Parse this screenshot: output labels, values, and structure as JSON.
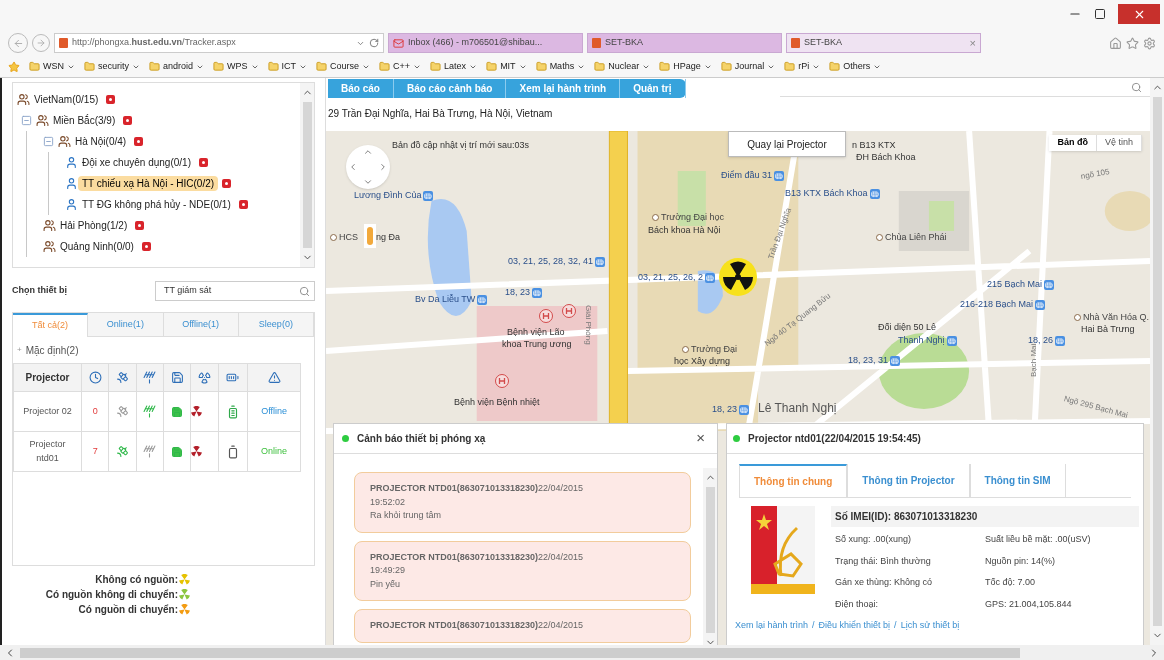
{
  "browser": {
    "url": "http://phongxa.**hust.edu.vn**/Tracker.aspx",
    "tabs": [
      {
        "label": "Inbox (466) - m706501@shibau...",
        "kind": "mail",
        "selected": false
      },
      {
        "label": "SET-BKA",
        "kind": "site",
        "selected": false
      },
      {
        "label": "SET-BKA",
        "kind": "site",
        "selected": true
      }
    ],
    "close_tab": "×",
    "bookmarks": [
      "WSN",
      "security",
      "android",
      "WPS",
      "ICT",
      "Course",
      "C++",
      "Latex",
      "MIT",
      "Maths",
      "Nuclear",
      "HPage",
      "Journal",
      "rPi",
      "Others"
    ]
  },
  "tree": [
    {
      "label": "VietNam(0/15)",
      "kind": "group",
      "selected": false,
      "children": [
        {
          "label": "Miền Bắc(3/9)",
          "kind": "group",
          "selected": false,
          "children": [
            {
              "label": "Hà Nội(0/4)",
              "kind": "group",
              "selected": false,
              "children": [
                {
                  "label": "Đội xe chuyên dụng(0/1)",
                  "kind": "unit",
                  "selected": false
                },
                {
                  "label": "TT chiếu xạ Hà Nội - HIC(0/2)",
                  "kind": "unit",
                  "selected": true
                },
                {
                  "label": "TT ĐG không phá hủy - NDE(0/1)",
                  "kind": "unit",
                  "selected": false
                }
              ]
            },
            {
              "label": "Hải Phòng(1/2)",
              "kind": "group",
              "selected": false
            },
            {
              "label": "Quảng Ninh(0/0)",
              "kind": "group",
              "selected": false
            }
          ]
        }
      ]
    }
  ],
  "device_picker": {
    "label": "Chọn thiết bị",
    "value": "TT giám sát"
  },
  "device_tabs": [
    {
      "label": "Tất cả(2)",
      "selected": true
    },
    {
      "label": "Online(1)",
      "selected": false
    },
    {
      "label": "Offline(1)",
      "selected": false
    },
    {
      "label": "Sleep(0)",
      "selected": false
    }
  ],
  "group": {
    "toggle": "+",
    "label": "Mặc định(2)"
  },
  "device_table": {
    "column": "Projector",
    "rows": [
      {
        "name": "Projector 02",
        "count": "0",
        "gps": false,
        "signal": true,
        "battery_full": true,
        "status": "Offline",
        "online": false
      },
      {
        "name": "Projector ntd01",
        "count": "7",
        "gps": true,
        "signal": false,
        "battery_full": false,
        "status": "Online",
        "online": true
      }
    ]
  },
  "legend": [
    {
      "label": "Không có nguồn:",
      "color": "#e6c200"
    },
    {
      "label": "Có nguồn không di chuyển:",
      "color": "#8cc63f"
    },
    {
      "label": "Có nguồn di chuyển:",
      "color": "#f39c12"
    }
  ],
  "nav": [
    "Báo cáo",
    "Báo cáo cảnh báo",
    "Xem lại hành trình",
    "Quản trị"
  ],
  "address_line": "29 Trần Đại Nghĩa, Hai Bà Trưng, Hà Nội, Vietnam",
  "map": {
    "notice": "Bản đồ cập nhật vị trí mới sau:03s",
    "back_button": "Quay lại Projector",
    "map_types": [
      {
        "label": "Bản đồ",
        "selected": true
      },
      {
        "label": "Vệ tinh",
        "selected": false
      }
    ],
    "labels": [
      {
        "text": "n B13 KTX",
        "kind": "text"
      },
      {
        "text": "ĐH Bách Khoa",
        "kind": "text"
      },
      {
        "text": "Điểm đầu 31",
        "kind": "bus"
      },
      {
        "text": "Lương Đình Của",
        "kind": "bus"
      },
      {
        "text": "B13 KTX Bách Khoa",
        "kind": "bus"
      },
      {
        "text": "HCS",
        "kind": "place"
      },
      {
        "text": "ng Đa",
        "kind": "text"
      },
      {
        "text": "Trường Đại học",
        "kind": "place"
      },
      {
        "text": "Bách khoa Hà Nội",
        "kind": "text"
      },
      {
        "text": "Chùa Liên Phái",
        "kind": "place"
      },
      {
        "text": "03, 21, 25, 28, 32, 41",
        "kind": "bus"
      },
      {
        "text": "03, 21, 25, 26, 2",
        "kind": "bus"
      },
      {
        "text": "18, 23",
        "kind": "bus"
      },
      {
        "text": "Bv Da Liễu TW",
        "kind": "bus"
      },
      {
        "text": "215 Bạch Mai",
        "kind": "bus"
      },
      {
        "text": "216-218 Bạch Mai",
        "kind": "bus"
      },
      {
        "text": "Nhà Văn Hóa Q.",
        "kind": "place"
      },
      {
        "text": "Bệnh viện Lão",
        "kind": "text"
      },
      {
        "text": "Đối diện 50 Lê",
        "kind": "text"
      },
      {
        "text": "Hai Bà Trưng",
        "kind": "text"
      },
      {
        "text": "khoa Trung ương",
        "kind": "text"
      },
      {
        "text": "Thanh Nghị",
        "kind": "bus"
      },
      {
        "text": "18, 26",
        "kind": "bus"
      },
      {
        "text": "Trường Đại",
        "kind": "place"
      },
      {
        "text": "học Xây dựng",
        "kind": "text"
      },
      {
        "text": "18, 23, 31",
        "kind": "bus"
      },
      {
        "text": "Bệnh viện Bệnh nhiệt",
        "kind": "text"
      },
      {
        "text": "18, 23",
        "kind": "bus"
      },
      {
        "text": "Lê Thanh Nghị",
        "kind": "street"
      },
      {
        "text": "Giải Phóng",
        "kind": "road"
      },
      {
        "text": "Trần Đại Nghĩa",
        "kind": "road"
      },
      {
        "text": "Ngõ 40 Tạ Quang Bửu",
        "kind": "road"
      },
      {
        "text": "Bạch Mai",
        "kind": "road"
      },
      {
        "text": "ngõ 105",
        "kind": "road"
      },
      {
        "text": "Ngõ 295 Bạch Mai",
        "kind": "road"
      }
    ]
  },
  "alerts": {
    "title": "Cảnh báo thiết bị phóng xạ",
    "close": "×",
    "items": [
      {
        "title": "**PROJECTOR NTD01(863071013318230)**22/04/2015",
        "time": "19:52:02",
        "message": "Ra khỏi trung tâm"
      },
      {
        "title": "**PROJECTOR NTD01(863071013318230)**22/04/2015",
        "time": "19:49:29",
        "message": "Pin yếu"
      },
      {
        "title": "**PROJECTOR NTD01(863071013318230)**22/04/2015"
      }
    ]
  },
  "device_info": {
    "title": "Projector ntd01(22/04/2015 19:54:45)",
    "tabs": [
      {
        "label": "Thông tin chung",
        "selected": true
      },
      {
        "label": "Thông tin Projector",
        "selected": false
      },
      {
        "label": "Thông tin SIM",
        "selected": false
      }
    ],
    "imei": "Số IMEI(ID): 863071013318230",
    "fields": [
      "Số xung: .00(xung)",
      "Suất liều bề mặt: .00(uSV)",
      "Trạng thái: Bình thường",
      "Nguồn pin: 14(%)",
      "Gán xe thùng: Không có",
      "Tốc độ: 7.00",
      "Điện thoại:",
      "GPS: 21.004,105.844"
    ],
    "links": [
      "Xem lại hành trình",
      "Điều khiển thiết bị",
      "Lịch sử thiết bị"
    ],
    "separator": "/"
  }
}
